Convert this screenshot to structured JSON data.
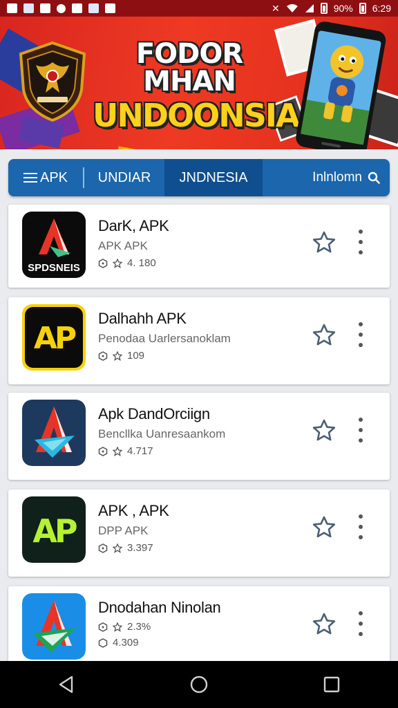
{
  "status_bar": {
    "battery": "90%",
    "time": "6:29"
  },
  "banner": {
    "title_line1": "FODOR MHAN",
    "title_line2": "UNDOONSIA",
    "emblem_icon": "garuda-emblem-icon",
    "phone_icon": "phone-mascot-icon"
  },
  "nav": {
    "tab_apk": "APK",
    "tab_undiar": "UNDIAR",
    "tab_indonesia": "JNDNESIA",
    "search_label": "Inlnlomn",
    "active_tab": "tab_indonesia"
  },
  "apps": [
    {
      "name": "DarK, APK",
      "subtitle": "APK APK",
      "rating": "4. 180",
      "icon_text": "SPDSNEIS",
      "icon_bg": "#0b0b0b"
    },
    {
      "name": "Dalhahh APK",
      "subtitle": "Penodaa Uarlersanoklam",
      "rating": "109",
      "icon_text": "AP",
      "icon_bg": "#0b0b0b",
      "accent": "#f7d10a"
    },
    {
      "name": "Apk DandOrciign",
      "subtitle": "Bencllka Uanresaankom",
      "rating": "4.717",
      "icon_text": "",
      "icon_bg": "#1d3a5e"
    },
    {
      "name": "APK , APK",
      "subtitle": "DPP APK",
      "rating": "3.397",
      "icon_text": "AP",
      "icon_bg": "#10201a",
      "accent": "#b5f233"
    },
    {
      "name": "Dnodahan Ninolan",
      "subtitle": "",
      "rating": "2.3%",
      "rating2": "4.309",
      "icon_text": "",
      "icon_bg": "#1a8ee6"
    }
  ],
  "colors": {
    "status_bar": "#8e0f12",
    "nav_bar": "#1b66ad",
    "nav_active": "#0f4f8f"
  }
}
